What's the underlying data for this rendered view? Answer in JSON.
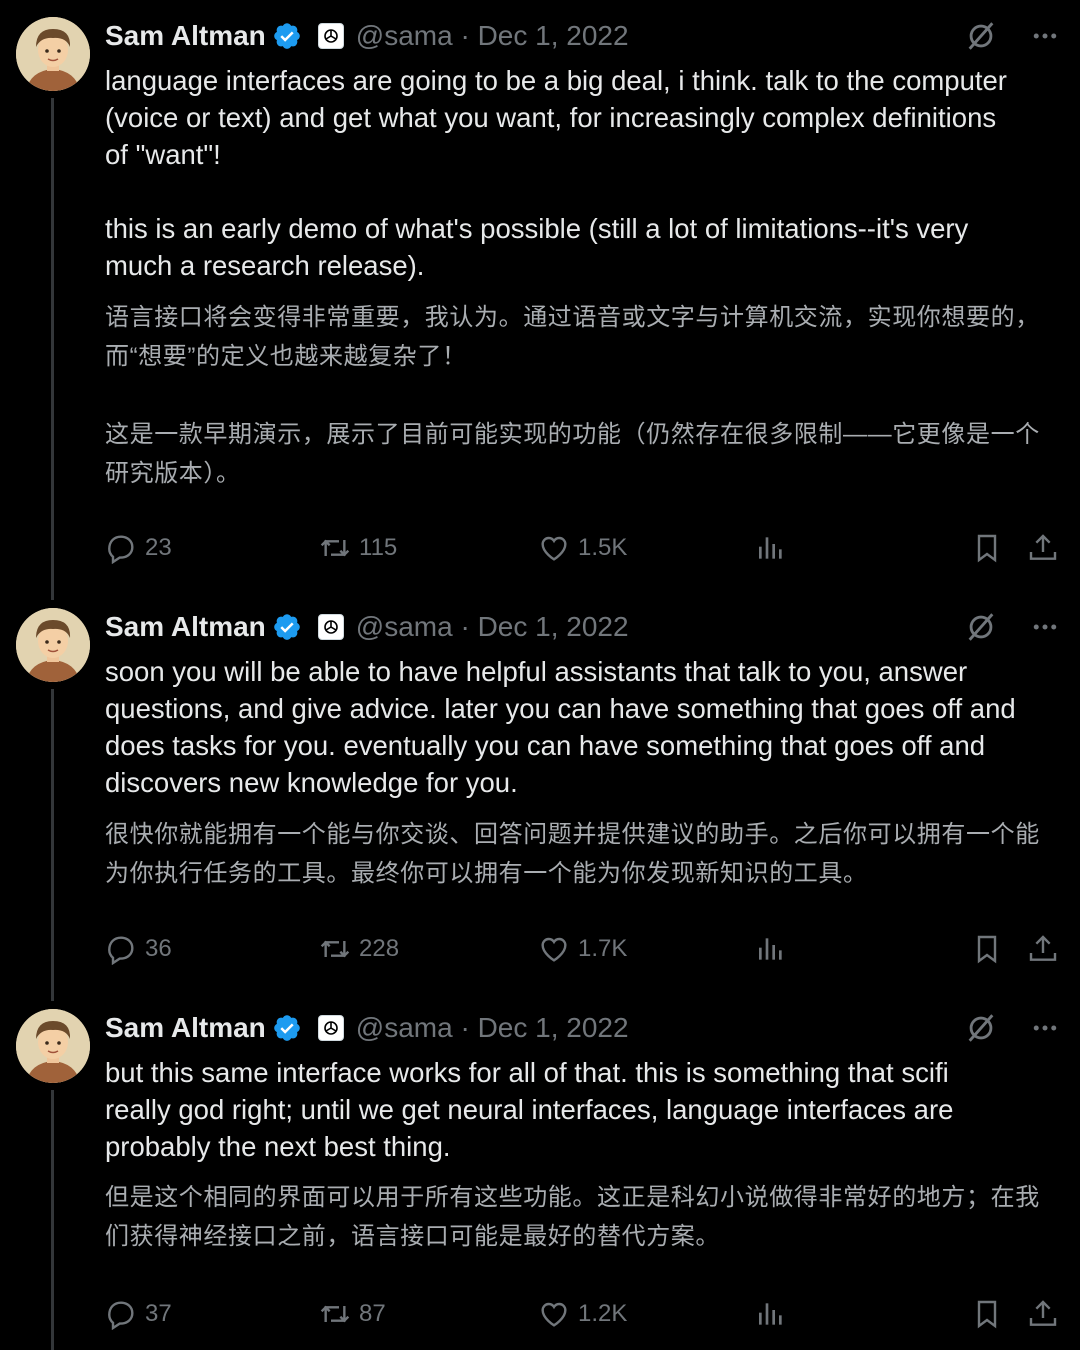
{
  "tweets": [
    {
      "author": "Sam Altman",
      "handle": "@sama",
      "separator": "·",
      "date": "Dec 1, 2022",
      "text_en": "language interfaces are going to be a big deal, i think. talk to the computer\n(voice or text) and get what you want, for increasingly complex definitions\nof \"want\"!\n\nthis is an early demo of what's possible (still a lot of limitations--it's very\nmuch a research release).",
      "text_zh": "语言接口将会变得非常重要，我认为。通过语音或文字与计算机交流，实现你想要的，\n而“想要”的定义也越来越复杂了！\n\n这是一款早期演示，展示了目前可能实现的功能（仍然存在很多限制——它更像是一个\n研究版本）。",
      "replies": "23",
      "reposts": "115",
      "likes": "1.5K"
    },
    {
      "author": "Sam Altman",
      "handle": "@sama",
      "separator": "·",
      "date": "Dec 1, 2022",
      "text_en": "soon you will be able to have helpful assistants that talk to you, answer\nquestions, and give advice. later you can have something that goes off and\ndoes tasks for you. eventually you can have something that goes off and\ndiscovers new knowledge for you.",
      "text_zh": "很快你就能拥有一个能与你交谈、回答问题并提供建议的助手。之后你可以拥有一个能\n为你执行任务的工具。最终你可以拥有一个能为你发现新知识的工具。",
      "replies": "36",
      "reposts": "228",
      "likes": "1.7K"
    },
    {
      "author": "Sam Altman",
      "handle": "@sama",
      "separator": "·",
      "date": "Dec 1, 2022",
      "text_en": "but this same interface works for all of that. this is something that scifi\nreally god right; until we get neural interfaces, language interfaces are\nprobably the next best thing.",
      "text_zh": "但是这个相同的界面可以用于所有这些功能。这正是科幻小说做得非常好的地方；在我\n们获得神经接口之前，语言接口可能是最好的替代方案。",
      "replies": "37",
      "reposts": "87",
      "likes": "1.2K"
    }
  ],
  "icons": {
    "verified": "verified-badge-icon",
    "org": "openai-org-badge-icon",
    "grok": "grok-icon",
    "more": "more-options-icon",
    "reply": "reply-icon",
    "repost": "repost-icon",
    "like": "like-icon",
    "views": "views-icon",
    "bookmark": "bookmark-icon",
    "share": "share-icon"
  },
  "colors": {
    "background": "#000000",
    "text": "#e7e9ea",
    "muted": "#71767b",
    "verified": "#1d9bf0"
  }
}
